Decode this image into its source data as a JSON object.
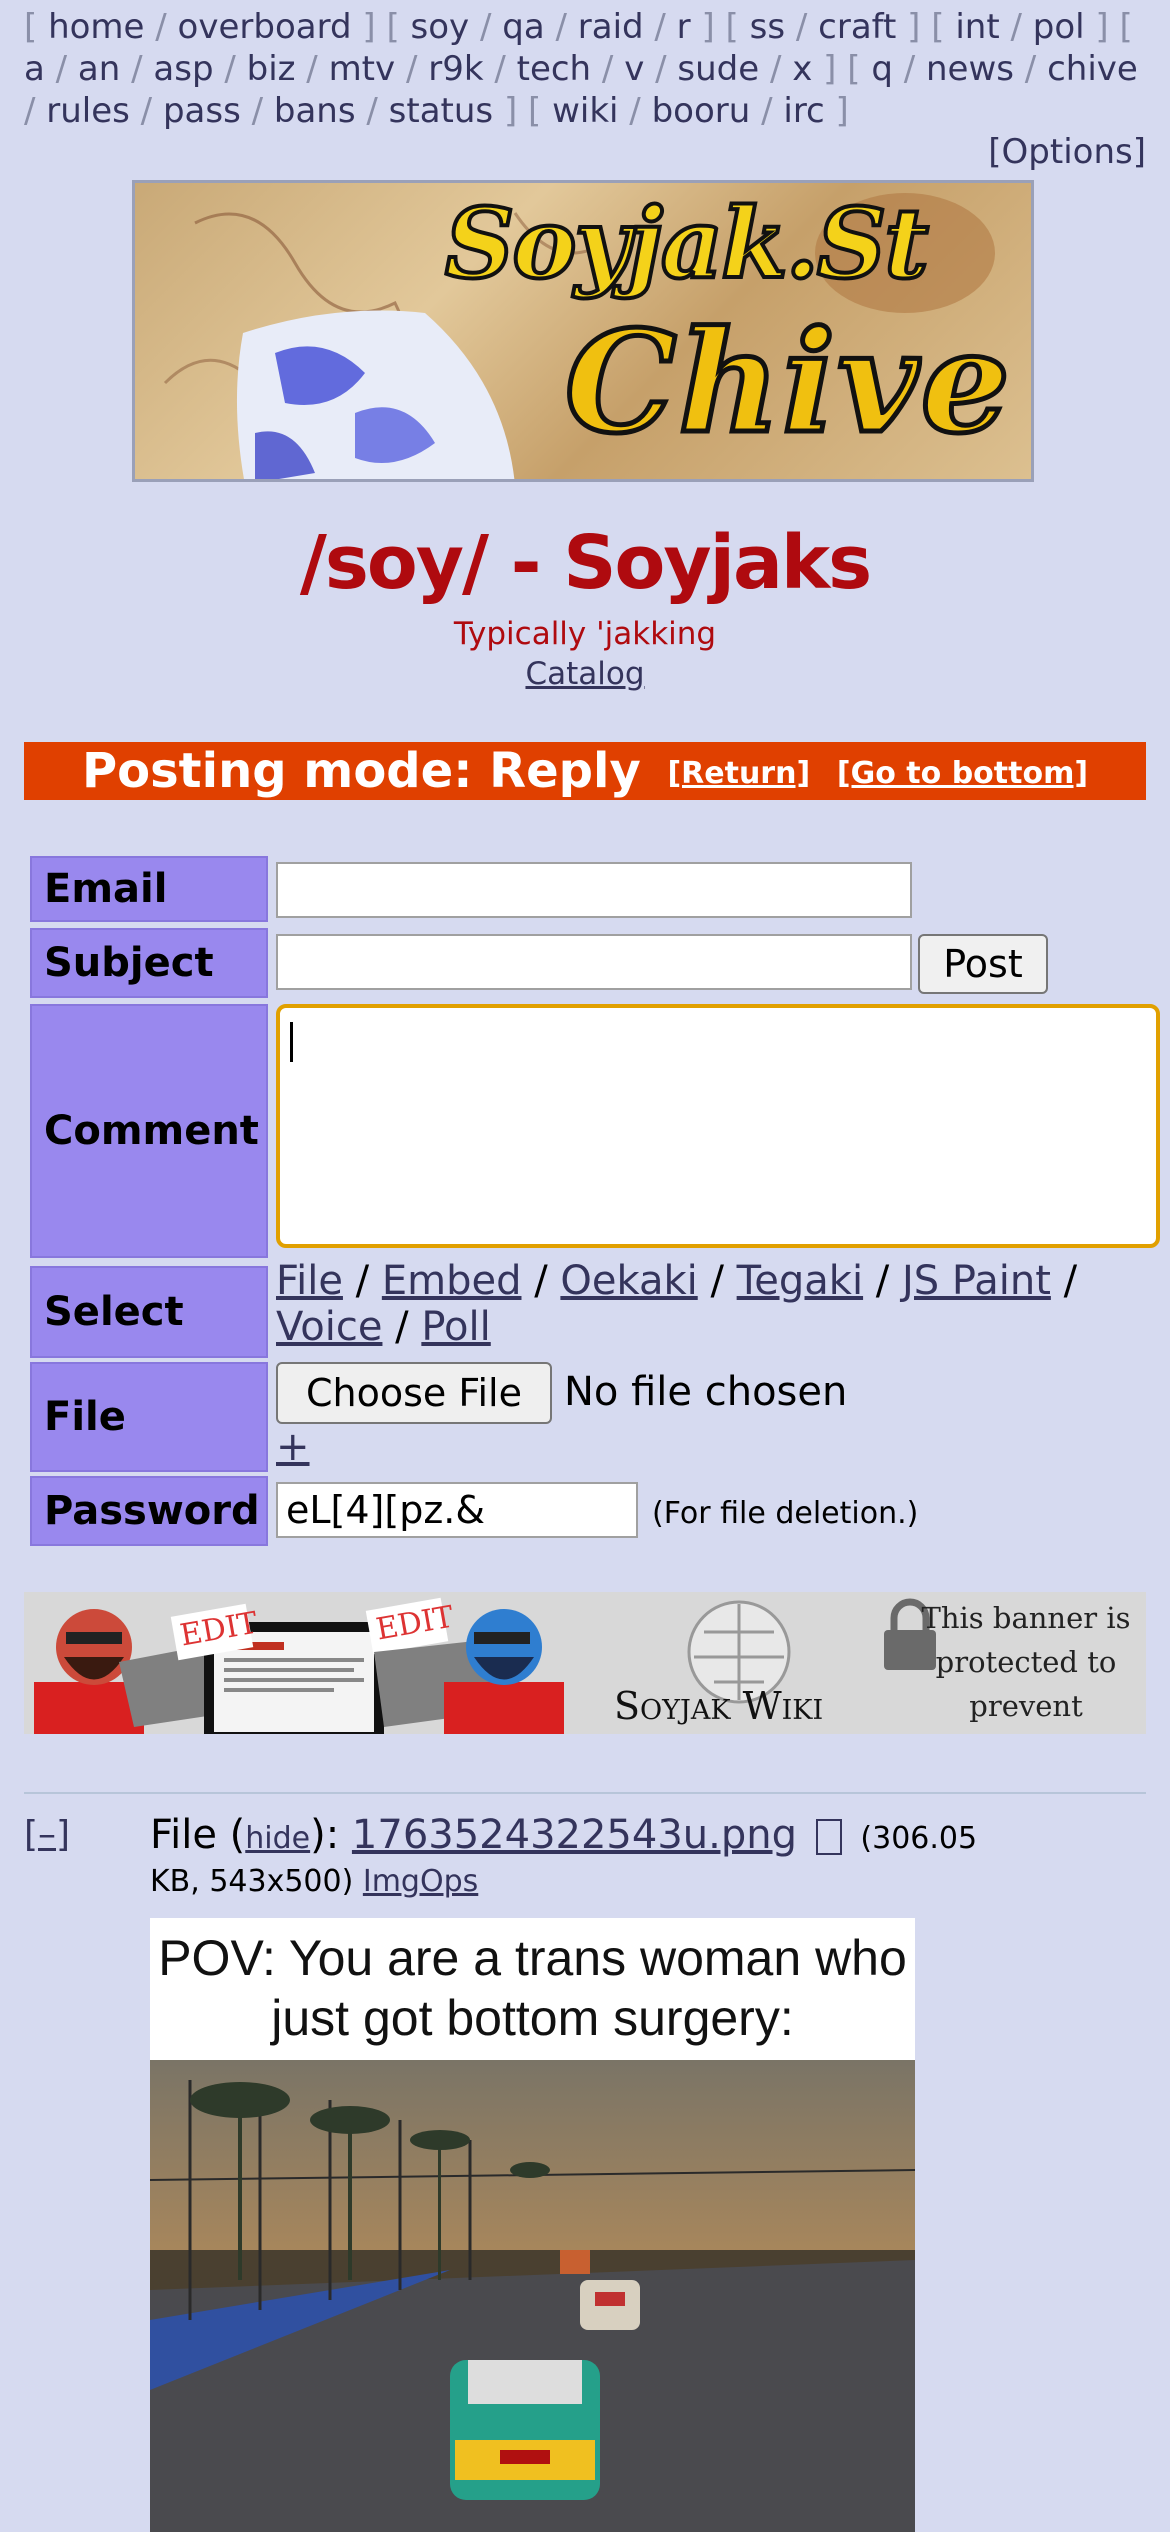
{
  "boardlist": {
    "groups": [
      [
        "home",
        "overboard"
      ],
      [
        "soy",
        "qa",
        "raid",
        "r"
      ],
      [
        "ss",
        "craft"
      ],
      [
        "int",
        "pol"
      ],
      [
        "a",
        "an",
        "asp",
        "biz",
        "mtv",
        "r9k",
        "tech",
        "v",
        "sude",
        "x"
      ],
      [
        "q",
        "news",
        "chive",
        "rules",
        "pass",
        "bans",
        "status"
      ],
      [
        "wiki",
        "booru",
        "irc"
      ]
    ],
    "options_label": "[Options]"
  },
  "banner": {
    "text_line1": "Soyjak.St",
    "text_line2": "Chive"
  },
  "board": {
    "title": "/soy/ - Soyjaks",
    "subtitle": "Typically 'jakking",
    "catalog_label": "Catalog"
  },
  "posting_mode": {
    "label": "Posting mode: Reply",
    "return_label": "[Return]",
    "bottom_label": "[Go to bottom]"
  },
  "form": {
    "email_label": "Email",
    "subject_label": "Subject",
    "post_button": "Post",
    "comment_label": "Comment",
    "select_label": "Select",
    "select_options": [
      "File",
      "Embed",
      "Oekaki",
      "Tegaki",
      "JS Paint",
      "Voice",
      "Poll"
    ],
    "file_label": "File",
    "choose_file_button": "Choose File",
    "no_file_text": "No file chosen",
    "add_file": "+",
    "password_label": "Password",
    "password_value": "eL[4][pz.&",
    "password_note": "(For file deletion.)"
  },
  "wiki_banner": {
    "edit_text": "EDIT",
    "wiki_name": "Soyjak Wiki",
    "protected_text": "This banner is protected to prevent vandalism"
  },
  "post": {
    "collapse_label": "[–]",
    "file_prefix": "File (",
    "hide_label": "hide",
    "file_mid": "): ",
    "filename": "1763524322543u.png",
    "file_icon": "external-icon",
    "size_start": "(306.05",
    "size_rest": "KB, 543x500)",
    "imgops_label": "ImgOps",
    "image_caption": "POV: You are a trans woman who just got bottom surgery:"
  }
}
